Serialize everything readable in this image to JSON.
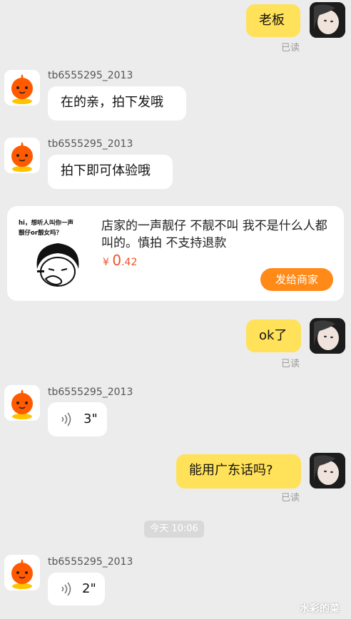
{
  "messages": {
    "m1": {
      "text": "老板",
      "status": "已读"
    },
    "m2": {
      "sender": "tb6555295_2013",
      "text": "在的亲，拍下发哦"
    },
    "m3": {
      "sender": "tb6555295_2013",
      "text": "拍下即可体验哦"
    },
    "m4": {
      "text": "ok了",
      "status": "已读"
    },
    "m5": {
      "sender": "tb6555295_2013",
      "duration": "3\""
    },
    "m6": {
      "text": "能用广东话吗?",
      "status": "已读"
    },
    "timestamp": "今天 10:06",
    "m7": {
      "sender": "tb6555295_2013",
      "duration": "2\""
    }
  },
  "product_card": {
    "sticker_caption_line1": "hi，想听人叫你一声",
    "sticker_caption_line2": "靓仔or靓女吗？",
    "title": "店家的一声靓仔 不靓不叫 我不是什么人都叫的。慎拍 不支持退款",
    "price_currency": "¥",
    "price_int": "0",
    "price_dec": ".42",
    "send_button": "发给商家"
  },
  "watermark": "水彩的菜",
  "colors": {
    "bubble_yellow": "#ffe15a",
    "accent_orange": "#ff8a18",
    "price_red": "#f0532a"
  }
}
